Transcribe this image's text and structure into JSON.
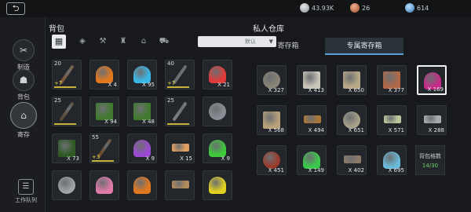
{
  "header": {
    "back_icon": "back-arrow-icon",
    "currencies": [
      {
        "icon": "silver-coin-icon",
        "value": "43.93K",
        "color": "#b8bcc2"
      },
      {
        "icon": "copper-coin-icon",
        "value": "26",
        "color": "#c0603a"
      },
      {
        "icon": "blue-gem-icon",
        "value": "614",
        "color": "#4a90c8"
      }
    ]
  },
  "sidebar": {
    "items": [
      {
        "label": "制造",
        "icon": "hammer-icon"
      },
      {
        "label": "背包",
        "icon": "bag-icon"
      },
      {
        "label": "寄存",
        "icon": "house-icon",
        "active": true
      }
    ],
    "queue": {
      "label": "工作队列",
      "icon": "task-list-icon"
    }
  },
  "backpack": {
    "title": "背包",
    "filters": [
      "grid-all-icon",
      "material-icon",
      "tools-icon",
      "potion-icon",
      "building-icon",
      "cart-icon"
    ],
    "sort": {
      "value": "默认"
    },
    "slots": [
      {
        "top": "20",
        "plus": "+7",
        "bar": true,
        "icon": "spear-icon",
        "color": "#7a5a3a"
      },
      {
        "count": "X 4",
        "icon": "fire-icon",
        "color": "#e2781e"
      },
      {
        "count": "X 95",
        "icon": "blue-powder-icon",
        "color": "#3bb7e6"
      },
      {
        "top": "40",
        "plus": "+7",
        "bar": true,
        "icon": "bow-icon",
        "color": "#6a6f74"
      },
      {
        "count": "X 21",
        "icon": "red-powder-icon",
        "color": "#e03a3a"
      },
      {
        "top": "25",
        "bar": true,
        "icon": "staff-icon",
        "color": "#5a4a3a"
      },
      {
        "count": "X 94",
        "icon": "green-book-icon",
        "color": "#3f7a2e"
      },
      {
        "count": "X 48",
        "icon": "green-book-icon",
        "color": "#3f7a2e"
      },
      {
        "top": "25",
        "bar": true,
        "icon": "axe-icon",
        "color": "#7a7e84"
      },
      {
        "icon": "iron-ore-icon",
        "color": "#8a8e94"
      },
      {
        "count": "X 73",
        "icon": "green-book-icon",
        "color": "#2f5a24"
      },
      {
        "top": "55",
        "plus": "+3",
        "bar": true,
        "icon": "wand-icon",
        "color": "#6a4a2a"
      },
      {
        "count": "X 9",
        "icon": "purple-potion-icon",
        "color": "#9a4ad0"
      },
      {
        "count": "X 15",
        "icon": "bone-icon",
        "color": "#e0a060"
      },
      {
        "count": "X 9",
        "icon": "green-powder-icon",
        "color": "#3ec83a"
      },
      {
        "icon": "stone-icon",
        "color": "#a0a4a8"
      },
      {
        "icon": "pink-flask-icon",
        "color": "#e07aa8"
      },
      {
        "icon": "fire-icon",
        "color": "#e2781e"
      },
      {
        "icon": "horn-icon",
        "color": "#b08a5a"
      },
      {
        "icon": "yellow-powder-icon",
        "color": "#e0d020"
      }
    ]
  },
  "warehouse": {
    "title": "私人仓库",
    "tabs": [
      {
        "label": "寄存箱"
      },
      {
        "label": "专属寄存箱",
        "active": true
      }
    ],
    "slots": [
      {
        "count": "X 327",
        "icon": "scrap-icon",
        "color": "#8a8478"
      },
      {
        "count": "X 413",
        "icon": "cloth-icon",
        "color": "#c8c4b8"
      },
      {
        "count": "X 650",
        "icon": "paper-icon",
        "color": "#b8a888"
      },
      {
        "count": "X 377",
        "icon": "leather-icon",
        "color": "#b06848"
      },
      {
        "count": "X 169",
        "icon": "berry-icon",
        "color": "#c82a8a",
        "selected": true
      },
      {
        "count": "X 568",
        "icon": "scroll-icon",
        "color": "#b8a07a"
      },
      {
        "count": "X 494",
        "icon": "copper-ingot-icon",
        "color": "#a8783a"
      },
      {
        "count": "X 651",
        "icon": "chain-icon",
        "color": "#a8a088"
      },
      {
        "count": "X 571",
        "icon": "jade-bar-icon",
        "color": "#b8c89a"
      },
      {
        "count": "X 288",
        "icon": "silver-bar-icon",
        "color": "#a8aaac"
      },
      {
        "count": "X 451",
        "icon": "meat-icon",
        "color": "#9a3a2a"
      },
      {
        "count": "X 149",
        "icon": "green-potion-icon",
        "color": "#3ac84a"
      },
      {
        "count": "X 402",
        "icon": "wood-icon",
        "color": "#8a7a68"
      },
      {
        "count": "X 695",
        "icon": "crystal-icon",
        "color": "#6ab8d8"
      }
    ],
    "capacity": {
      "label": "背包格数",
      "value": "14/30"
    }
  }
}
